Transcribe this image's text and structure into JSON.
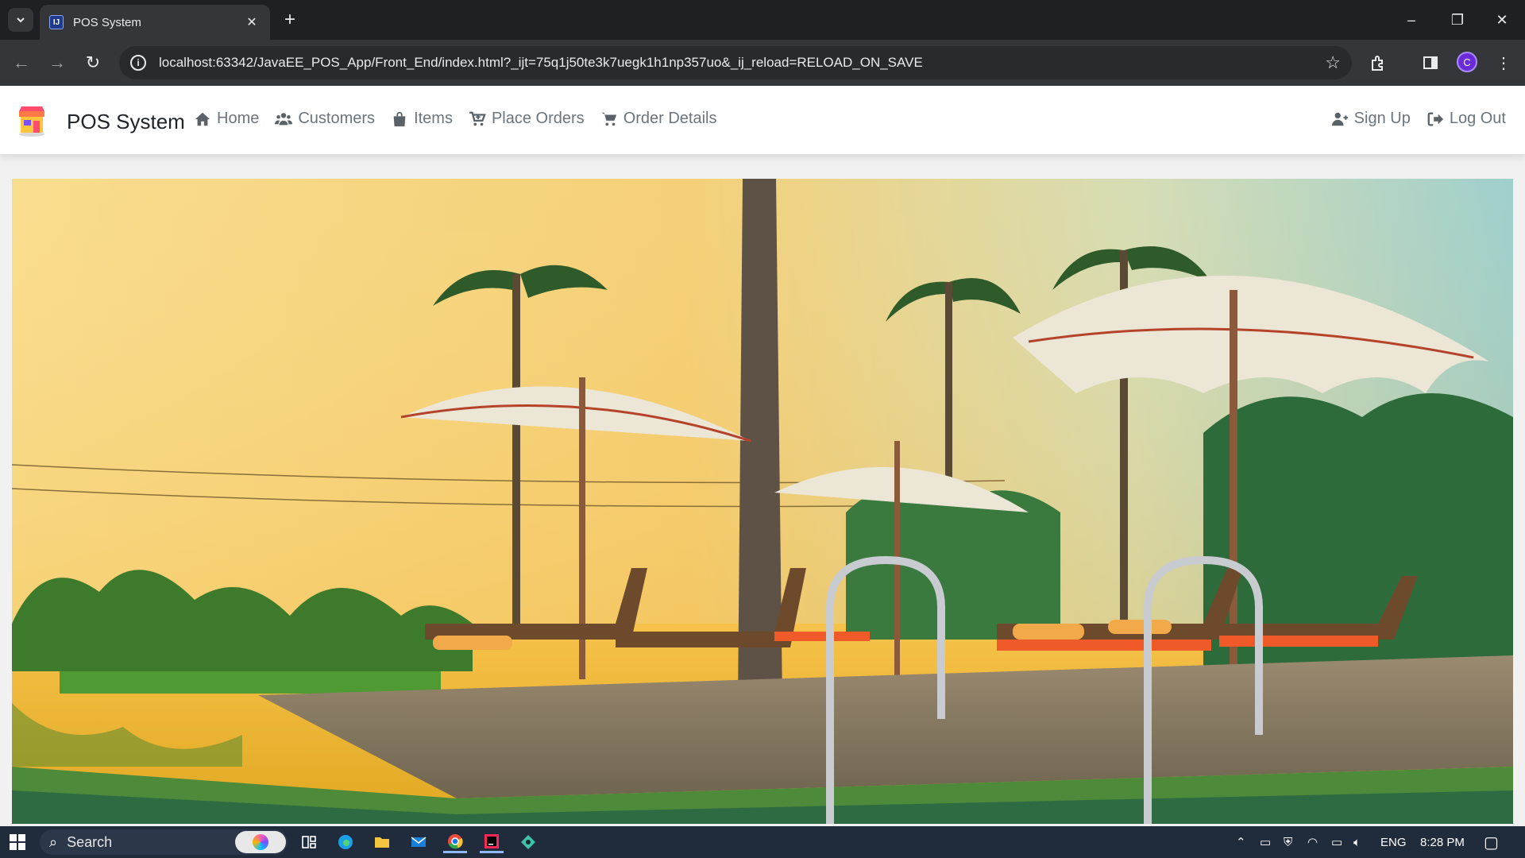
{
  "browser": {
    "tab_title": "POS System",
    "tab_favicon_text": "IJ",
    "url": "localhost:63342/JavaEE_POS_App/Front_End/index.html?_ijt=75q1j50te3k7uegk1h1np357uo&_ij_reload=RELOAD_ON_SAVE",
    "profile_initial": "C"
  },
  "navbar": {
    "brand": "POS System",
    "links": [
      {
        "label": "Home",
        "icon": "home-icon"
      },
      {
        "label": "Customers",
        "icon": "users-icon"
      },
      {
        "label": "Items",
        "icon": "shopping-bag-icon"
      },
      {
        "label": "Place Orders",
        "icon": "cart-plus-icon"
      },
      {
        "label": "Order Details",
        "icon": "cart-icon"
      }
    ],
    "right_links": [
      {
        "label": "Sign Up",
        "icon": "user-plus-icon"
      },
      {
        "label": "Log Out",
        "icon": "sign-out-icon"
      }
    ]
  },
  "hero": {
    "image": "tropical-resort-pool-photo"
  },
  "taskbar": {
    "search_label": "Search",
    "language": "ENG",
    "time": "8:28 PM"
  }
}
